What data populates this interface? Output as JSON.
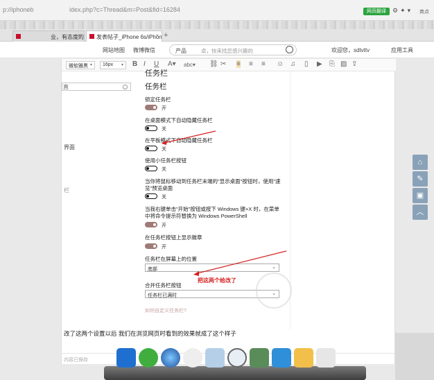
{
  "browser": {
    "address_left": "p://iphoneb",
    "address_mid": "idex.php?c=Thread&m=Post&fid=16284",
    "ext_badge": "网页翻译",
    "addr_right": "商点",
    "tabs": [
      {
        "label": "业，有态度的"
      },
      {
        "label": "发表帖子_iPhone 6s/iPhone 6"
      }
    ]
  },
  "site_nav": {
    "map": "网站地图",
    "weibo": "微博微信",
    "search_type": "产品",
    "search_placeholder": "卓，快来找您感兴趣的",
    "welcome": "欢迎您，sdtvttv",
    "apps": "应用工具"
  },
  "editor_toolbar": {
    "font_family": "微软雅黑",
    "font_size": "16px"
  },
  "settings": {
    "heading_cut": "任务栏",
    "heading": "任务栏",
    "side_labels": [
      "界面",
      "栏"
    ],
    "items": [
      {
        "label": "锁定任务栏",
        "state": "开"
      },
      {
        "label": "在桌面模式下自动隐藏任务栏",
        "state": "关"
      },
      {
        "label": "在平板模式下自动隐藏任务栏",
        "state": "关"
      },
      {
        "label": "使用小任务栏按钮",
        "state": "关"
      },
      {
        "label": "当你将鼠标移动到任务栏末端的\"显示桌面\"按钮时，使用\"速览\"预览桌面",
        "state": "关"
      },
      {
        "label": "当我右键单击\"开始\"按钮或按下 Windows 键+X 时，在菜单中将命令提示符替换为 Windows PowerShell",
        "state": "开"
      },
      {
        "label": "在任务栏按钮上显示徽章",
        "state": "开"
      }
    ],
    "position_label": "任务栏在屏幕上的位置",
    "position_value": "底部",
    "combine_label": "合并任务栏按钮",
    "combine_value": "任务栏已满时",
    "help_link": "如何自定义任务栏?",
    "annotation": "把这两个给改了"
  },
  "post": {
    "caption": "改了这两个设置以后 我们在浏览网页时看到的效果就成了这个样子",
    "status": "内容已保存"
  },
  "colors": {
    "toggle_on": "#9e7b76",
    "annotation_red": "#d61f1f",
    "float_button": "#8aa2b7"
  }
}
